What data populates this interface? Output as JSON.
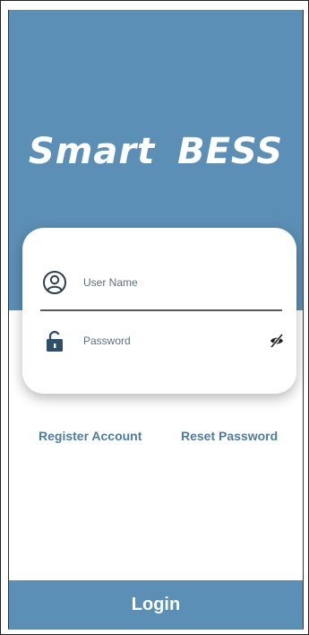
{
  "app": {
    "title": "Smart  BESS",
    "brand_color": "#5b8fb5",
    "link_color": "#4d7ca0"
  },
  "login_form": {
    "username": {
      "placeholder": "User Name",
      "icon": "user-circle-icon"
    },
    "password": {
      "placeholder": "Password",
      "icon": "lock-icon",
      "toggle_icon": "eye-off-icon"
    }
  },
  "links": {
    "register": "Register Account",
    "reset": "Reset Password"
  },
  "actions": {
    "login_label": "Login"
  }
}
